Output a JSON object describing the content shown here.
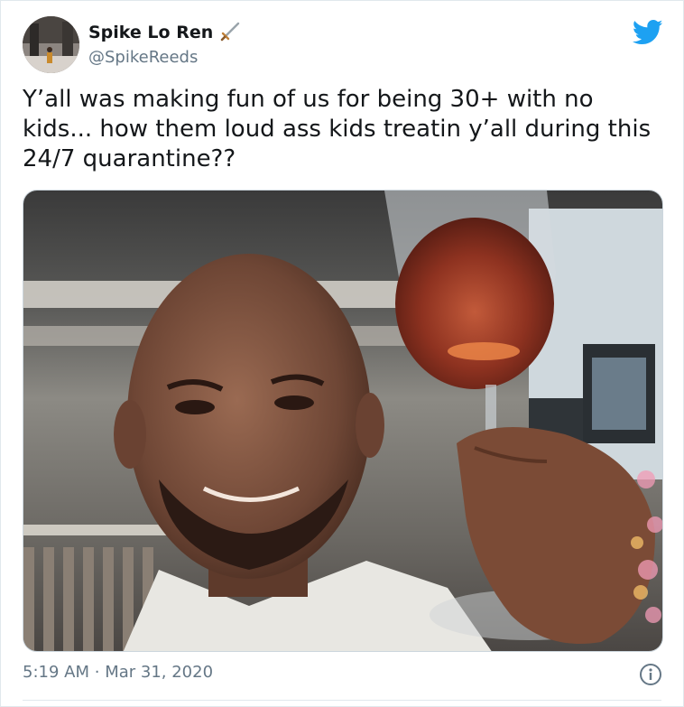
{
  "user": {
    "display_name": "Spike Lo Ren",
    "handle": "@SpikeReeds",
    "name_emoji": "dagger-emoji"
  },
  "tweet": {
    "text": "Y’all was making fun of us for being 30+ with no kids... how them loud ass kids treatin y’all during this 24/7 quarantine??",
    "time": "5:19 AM",
    "separator": "·",
    "date": "Mar 31, 2020"
  },
  "icons": {
    "brand": "twitter-bird-icon",
    "info": "info-icon"
  },
  "colors": {
    "brand": "#1da1f2",
    "secondary_text": "#657786",
    "border": "#e1e8ed"
  }
}
